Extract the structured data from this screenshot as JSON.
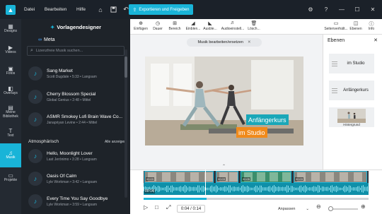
{
  "topbar": {
    "menu": [
      "Datei",
      "Bearbeiten",
      "Hilfe"
    ],
    "export_label": "Exportieren und Freigeben"
  },
  "leftnav": [
    {
      "icon": "designs-icon",
      "label": "Designs"
    },
    {
      "icon": "video-icon",
      "label": "Videos"
    },
    {
      "icon": "photo-icon",
      "label": "Fotos"
    },
    {
      "icon": "overlay-icon",
      "label": "Overlays"
    },
    {
      "icon": "library-icon",
      "label": "Meine Bibliothek"
    },
    {
      "icon": "text-icon",
      "label": "Text"
    },
    {
      "icon": "music-icon",
      "label": "Musik",
      "active": true
    },
    {
      "icon": "projects-icon",
      "label": "Projekte"
    }
  ],
  "designer": {
    "title": "Vorlagendesigner",
    "source": "Meta",
    "search_placeholder": "Lizenzfreie Musik suchen...",
    "tracks_top": [
      {
        "title": "Sang Market",
        "sub": "Scott Dugdale • 5:33 • Langsam"
      },
      {
        "title": "Cherry Blossom Special",
        "sub": "Global Genius • 2:48 • Mittel"
      },
      {
        "title": "ASMR Smokey Lofi Brain Wave Co...",
        "sub": "Janapriyan Levine • 2:44 • Mittel"
      }
    ],
    "section": {
      "title": "Atmosphärisch",
      "action": "Alle anzeigen"
    },
    "tracks_bottom": [
      {
        "title": "Hello, Moonlight Lover",
        "sub": "Last Jerónimo • 3:28 • Langsam"
      },
      {
        "title": "Oasis Of Calm",
        "sub": "Lyle Workman • 3:42 • Langsam"
      },
      {
        "title": "Every Time You Say Goodbye",
        "sub": "Lyle Workman • 3:59 • Langsam"
      }
    ]
  },
  "toolbar": [
    "Einfügen",
    "Dauer",
    "Bereich",
    "Einblen...",
    "Ausble...",
    "Audioeinstell...",
    "Lösch..."
  ],
  "toolbar_right": [
    "Seitenverhält...",
    "Ebenen",
    "Info"
  ],
  "preview": {
    "label": "Musik bearbeiten/ersetzen",
    "caption1": "Anfängerkurs",
    "caption2": "im Studio"
  },
  "layers": {
    "title": "Ebenen",
    "items": [
      "im Studio",
      "Anfängerkurs"
    ],
    "image_label": "Hintergrund"
  },
  "timeline": {
    "clip_badges": [
      "00:03",
      "00:03",
      "00:05",
      "00:03"
    ],
    "audio_badge": "00:14",
    "progress": 0.28
  },
  "controls": {
    "time": "0:04 / 0:14",
    "fit": "Anpassen"
  },
  "colors": {
    "accent": "#19b4d8",
    "dark": "#1e2329",
    "caption1": "#1aa7b8",
    "caption2": "#f08a1b"
  }
}
